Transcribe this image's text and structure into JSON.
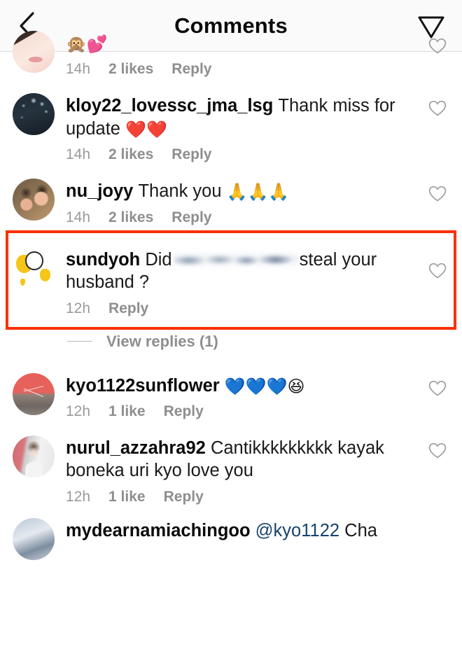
{
  "header": {
    "title": "Comments",
    "back_icon": "chevron-left-icon",
    "share_icon": "paper-plane-icon"
  },
  "labels": {
    "reply": "Reply",
    "like_heart_icon": "heart-outline-icon",
    "view_replies": "View replies (1)"
  },
  "comments": [
    {
      "username": "",
      "text": "",
      "emojis": "🙊💕",
      "time": "14h",
      "likes": "2 likes",
      "reply": "Reply",
      "avatar": "face-photo",
      "clipped": true
    },
    {
      "username": "kloy22_lovessc_jma_lsg",
      "text": "Thank miss for update",
      "emojis": "❤️❤️",
      "time": "14h",
      "likes": "2 likes",
      "reply": "Reply",
      "avatar": "dark-bokeh-photo"
    },
    {
      "username": "nu_joyy",
      "text": "Thank you",
      "emojis": "🙏🙏🙏",
      "time": "14h",
      "likes": "2 likes",
      "reply": "Reply",
      "avatar": "selfie-photo"
    },
    {
      "username": "sundyoh",
      "text_before_redaction": "Did",
      "redacted": true,
      "text_after_redaction": "steal your husband ?",
      "time": "12h",
      "likes": "",
      "reply": "Reply",
      "avatar": "cartoon-cat-illustration",
      "highlighted": true
    },
    {
      "username": "kyo1122sunflower",
      "text": "",
      "emojis": "💙💙💙😆",
      "time": "12h",
      "likes": "1 like",
      "reply": "Reply",
      "avatar": "song-handwriting-photo"
    },
    {
      "username": "nurul_azzahra92",
      "text": "Cantikkkkkkkkk kayak boneka uri kyo love you",
      "emojis": "",
      "time": "12h",
      "likes": "1 like",
      "reply": "Reply",
      "avatar": "woman-white-top-photo"
    },
    {
      "username": "mydearnamiachingoo",
      "mention": "@kyo1122",
      "text": "Cha",
      "avatar": "partial-photo",
      "partial": true
    }
  ],
  "colors": {
    "highlight": "#fc3000",
    "mention_link": "#17436e",
    "meta_gray": "#8e8e8e",
    "header_bg": "#fafafa"
  }
}
